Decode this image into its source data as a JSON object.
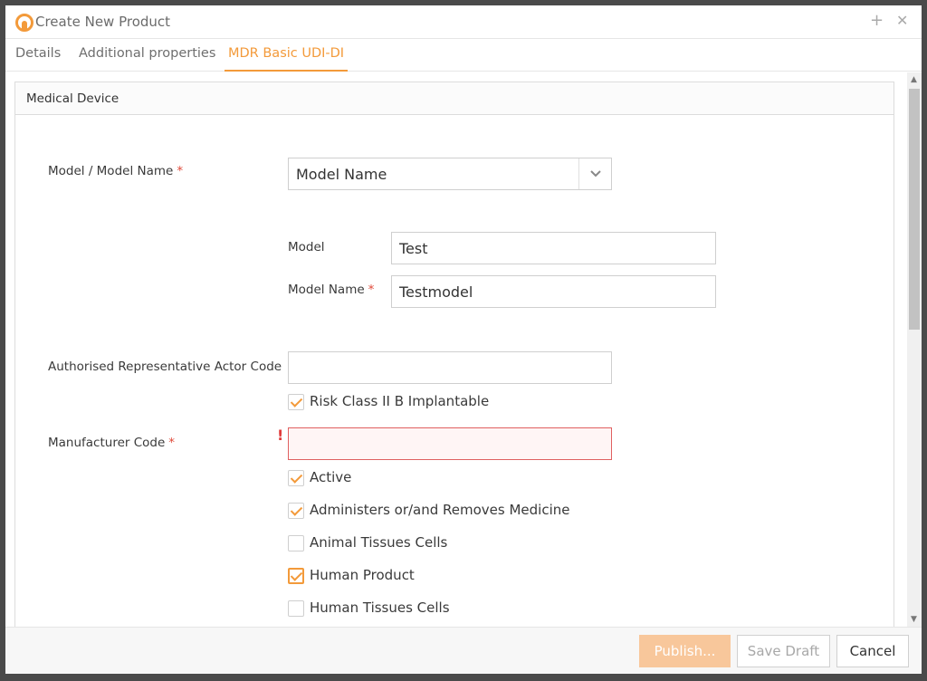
{
  "window": {
    "title": "Create New Product",
    "plus_icon": "+",
    "close_icon": "✕"
  },
  "tabs": [
    {
      "label": "Details",
      "active": false
    },
    {
      "label": "Additional properties",
      "active": false
    },
    {
      "label": "MDR Basic UDI-DI",
      "active": true
    }
  ],
  "panel": {
    "title": "Medical Device"
  },
  "form": {
    "model_model_name": {
      "label": "Model / Model Name",
      "required_mark": "*",
      "selected": "Model Name"
    },
    "model": {
      "label": "Model",
      "value": "Test"
    },
    "model_name": {
      "label": "Model Name",
      "required_mark": "*",
      "value": "Testmodel"
    },
    "authorised_rep": {
      "label": "Authorised Representative Actor Code",
      "value": ""
    },
    "risk_class": {
      "label": "Risk Class II B Implantable",
      "checked": true
    },
    "manufacturer_code": {
      "label": "Manufacturer Code",
      "required_mark": "*",
      "value": "",
      "error_mark": "!"
    },
    "checkboxes": [
      {
        "label": "Active",
        "checked": true
      },
      {
        "label": "Administers or/and Removes Medicine",
        "checked": true
      },
      {
        "label": "Animal Tissues Cells",
        "checked": false
      },
      {
        "label": "Human Product",
        "checked": true
      },
      {
        "label": "Human Tissues Cells",
        "checked": false
      }
    ]
  },
  "footer": {
    "publish": "Publish...",
    "save_draft": "Save Draft",
    "cancel": "Cancel"
  },
  "colors": {
    "accent": "#f39a3a",
    "required": "#e04a3a",
    "error_border": "#e06060"
  }
}
